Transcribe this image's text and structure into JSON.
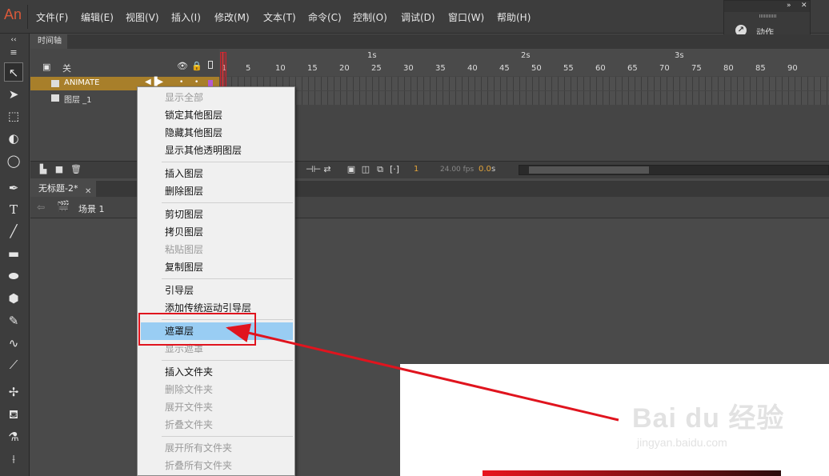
{
  "app": {
    "logo": "An"
  },
  "menubar": {
    "items": [
      "文件(F)",
      "编辑(E)",
      "视图(V)",
      "插入(I)",
      "修改(M)",
      "文本(T)",
      "命令(C)",
      "控制(O)",
      "调试(D)",
      "窗口(W)",
      "帮助(H)"
    ]
  },
  "action_panel": {
    "label": "动作"
  },
  "timeline": {
    "tab": "时间轴",
    "header_label": "关",
    "seconds": [
      "1s",
      "2s",
      "3s"
    ],
    "ruler": [
      "1",
      "5",
      "10",
      "15",
      "20",
      "25",
      "30",
      "35",
      "40",
      "45",
      "50",
      "55",
      "60",
      "65",
      "70",
      "75",
      "80",
      "85",
      "90"
    ],
    "layers": [
      {
        "name": "ANIMATE",
        "selected": true
      },
      {
        "name": "图层 _1",
        "selected": false
      }
    ],
    "current_frame": "1",
    "fps": "24.00 fps",
    "time": "0.0",
    "time_unit": "s"
  },
  "document": {
    "tab": "无标题-2*",
    "scene": "场景 1"
  },
  "context_menu": {
    "items": [
      {
        "label": "显示全部",
        "disabled": true
      },
      {
        "label": "锁定其他图层",
        "disabled": false
      },
      {
        "label": "隐藏其他图层",
        "disabled": false
      },
      {
        "label": "显示其他透明图层",
        "disabled": false
      },
      {
        "label": "插入图层",
        "disabled": false
      },
      {
        "label": "删除图层",
        "disabled": false
      },
      {
        "label": "剪切图层",
        "disabled": false
      },
      {
        "label": "拷贝图层",
        "disabled": false
      },
      {
        "label": "粘贴图层",
        "disabled": true
      },
      {
        "label": "复制图层",
        "disabled": false
      },
      {
        "label": "引导层",
        "disabled": false
      },
      {
        "label": "添加传统运动引导层",
        "disabled": false
      },
      {
        "label": "遮罩层",
        "disabled": false,
        "highlighted": true
      },
      {
        "label": "显示遮罩",
        "disabled": true
      },
      {
        "label": "插入文件夹",
        "disabled": false
      },
      {
        "label": "删除文件夹",
        "disabled": true
      },
      {
        "label": "展开文件夹",
        "disabled": true
      },
      {
        "label": "折叠文件夹",
        "disabled": true
      },
      {
        "label": "展开所有文件夹",
        "disabled": true
      },
      {
        "label": "折叠所有文件夹",
        "disabled": true
      }
    ]
  },
  "watermark": {
    "main": "Bai du 经验",
    "sub": "jingyan.baidu.com"
  },
  "colors": {
    "accent": "#e0141e",
    "highlight": "#99cdf3",
    "selected_layer": "#a87f2a",
    "frame_orange": "#e3a43a"
  }
}
